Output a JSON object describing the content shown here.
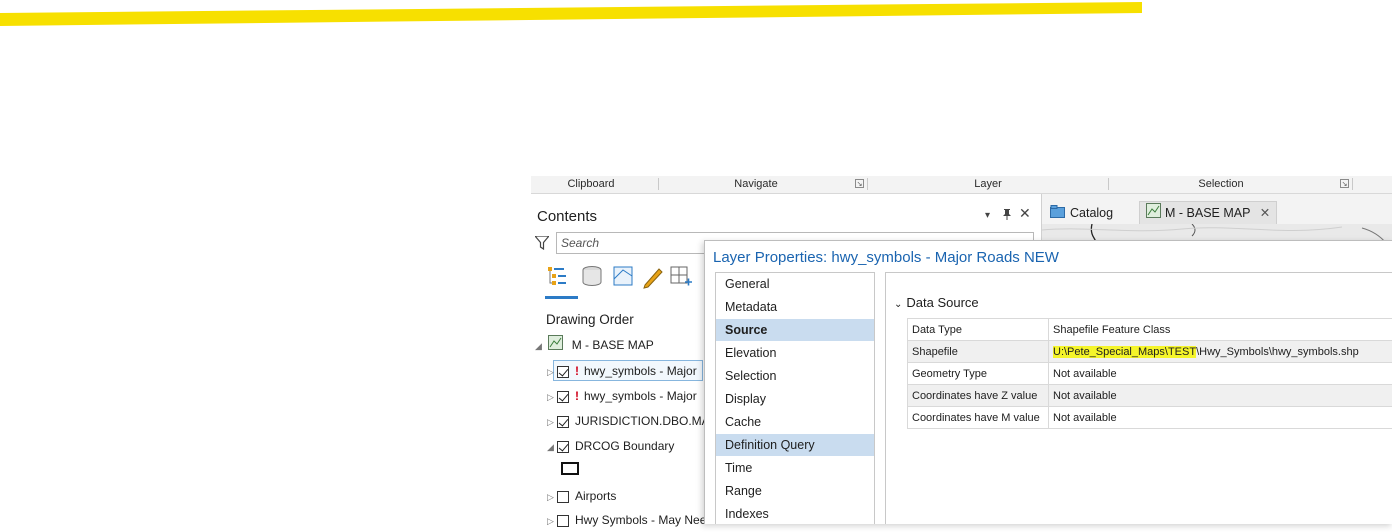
{
  "ribbon": {
    "groups": [
      "Clipboard",
      "Navigate",
      "Layer",
      "Selection"
    ]
  },
  "contents": {
    "title": "Contents",
    "search_placeholder": "Search",
    "section_title": "Drawing Order",
    "map_name": "M - BASE MAP",
    "layers": [
      {
        "label": "hwy_symbols - Major",
        "checked": true,
        "warning": true
      },
      {
        "label": "hwy_symbols - Major",
        "checked": true,
        "warning": true
      },
      {
        "label": "JURISDICTION.DBO.MAS",
        "checked": true,
        "warning": false
      },
      {
        "label": "DRCOG Boundary",
        "checked": true,
        "warning": false
      },
      {
        "label": "Airports",
        "checked": false,
        "warning": false
      },
      {
        "label": "Hwy Symbols - May Nee",
        "checked": false,
        "warning": false
      }
    ]
  },
  "map_tabs": {
    "catalog": "Catalog",
    "map": "M - BASE MAP"
  },
  "dialog": {
    "title": "Layer Properties: hwy_symbols - Major Roads NEW",
    "nav": [
      "General",
      "Metadata",
      "Source",
      "Elevation",
      "Selection",
      "Display",
      "Cache",
      "Definition Query",
      "Time",
      "Range",
      "Indexes"
    ],
    "section": "Data Source",
    "rows": [
      {
        "key": "Data Type",
        "value": "Shapefile Feature Class"
      },
      {
        "key": "Shapefile",
        "value_highlight": "U:\\Pete_Special_Maps\\TEST",
        "value_rest": "\\Hwy_Symbols\\hwy_symbols.shp"
      },
      {
        "key": "Geometry Type",
        "value": "Not available"
      },
      {
        "key": "Coordinates have Z value",
        "value": "Not available"
      },
      {
        "key": "Coordinates have M value",
        "value": "Not available"
      }
    ]
  },
  "colors": {
    "accent": "#1a64b0",
    "highlight": "#f5f52a",
    "marker": "#f7e000",
    "selected_nav": "#c9dcef"
  }
}
